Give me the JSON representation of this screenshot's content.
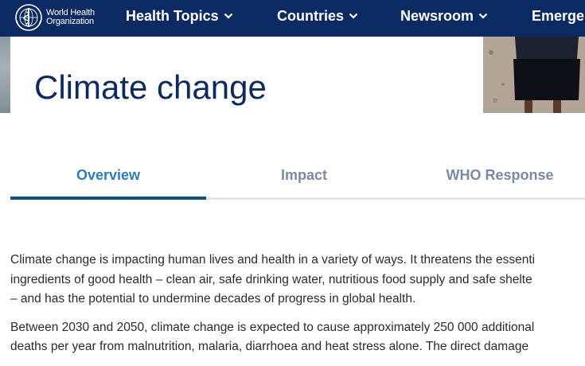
{
  "brand": {
    "name_line1": "World Health",
    "name_line2": "Organization",
    "logo_icon": "who-emblem-icon"
  },
  "nav": {
    "items": [
      {
        "label": "Health Topics",
        "has_dropdown": true
      },
      {
        "label": "Countries",
        "has_dropdown": true
      },
      {
        "label": "Newsroom",
        "has_dropdown": true
      },
      {
        "label": "Emerge",
        "has_dropdown": false
      }
    ],
    "background": "#0b2a64"
  },
  "hero": {
    "title": "Climate change"
  },
  "tabs": {
    "items": [
      {
        "label": "Overview",
        "active": true
      },
      {
        "label": "Impact",
        "active": false
      },
      {
        "label": "WHO Response",
        "active": false
      }
    ],
    "active_color": "#2a7cc3",
    "inactive_color": "#7a8aa6",
    "indicator_color": "#0b4f8a"
  },
  "content": {
    "paragraph1_line1": "Climate change is impacting human lives and health in a variety of ways. It threatens the essenti",
    "paragraph1_line2": "ingredients of good health – clean air, safe drinking water, nutritious food supply and safe shelte",
    "paragraph1_line3": "– and has the potential to undermine decades of progress in global health.",
    "paragraph2_line1": "Between 2030 and 2050, climate change is expected to cause approximately 250 000 additional",
    "paragraph2_line2": "deaths per year from malnutrition, malaria, diarrhoea and heat stress alone. The direct damage"
  }
}
